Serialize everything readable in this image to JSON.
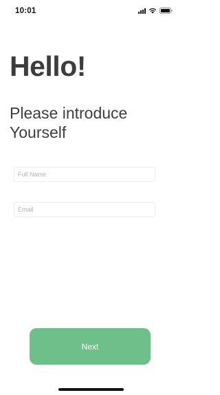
{
  "status_bar": {
    "time": "10:01",
    "icons": [
      "signal-icon",
      "wifi-icon",
      "battery-icon"
    ]
  },
  "header": {
    "title": "Hello!",
    "subtitle": "Please introduce Yourself"
  },
  "form": {
    "full_name": {
      "placeholder": "Full Name",
      "value": ""
    },
    "email": {
      "placeholder": "Email",
      "value": ""
    }
  },
  "actions": {
    "next_label": "Next"
  },
  "colors": {
    "accent": "#6fbf8b",
    "heading": "#3d3d3d",
    "field_border": "#ececec",
    "placeholder": "#b5b5b5"
  }
}
